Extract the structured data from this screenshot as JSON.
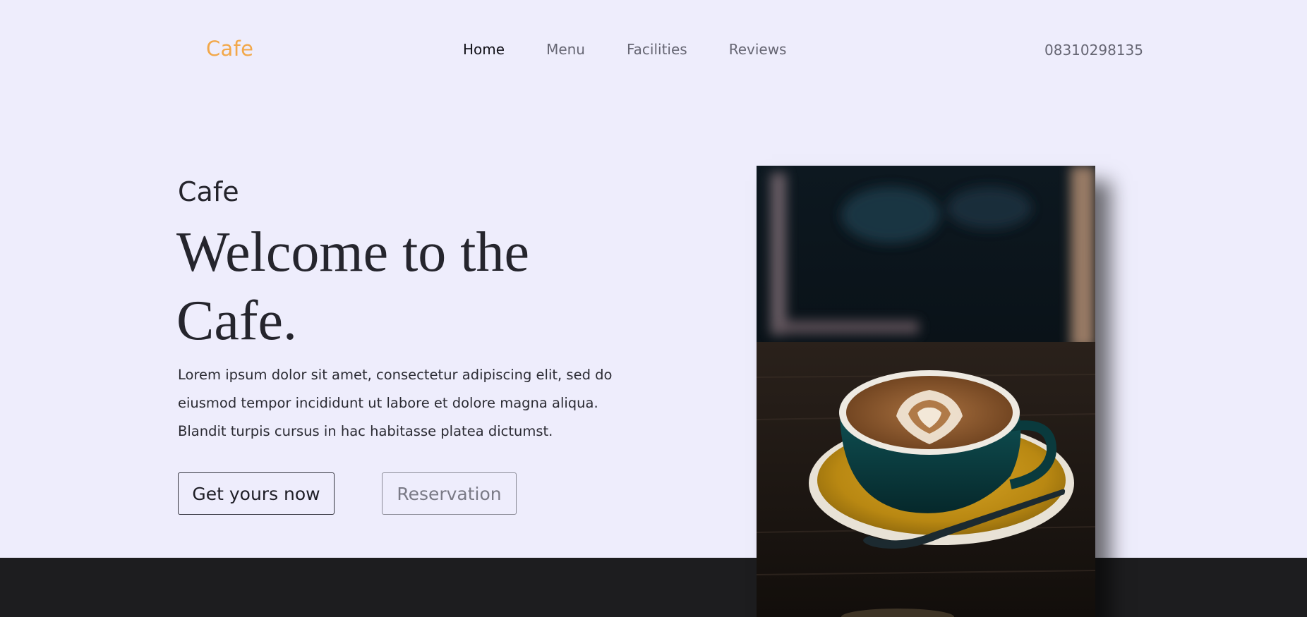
{
  "brand": {
    "name": "Cafe",
    "color": "#f2a84a"
  },
  "nav": {
    "items": [
      {
        "label": "Home",
        "active": true
      },
      {
        "label": "Menu",
        "active": false
      },
      {
        "label": "Facilities",
        "active": false
      },
      {
        "label": "Reviews",
        "active": false
      }
    ]
  },
  "contact": {
    "phone": "08310298135"
  },
  "hero": {
    "eyebrow": "Cafe",
    "headline_line1": "Welcome to the",
    "headline_line2": "Cafe.",
    "lede_line1": "Lorem ipsum dolor sit amet, consectetur adipiscing elit, sed do",
    "lede_line2": "eiusmod tempor incididunt ut labore et dolore magna aliqua.",
    "lede_line3": "Blandit turpis cursus in hac habitasse platea dictumst.",
    "primary_button": "Get yours now",
    "secondary_button": "Reservation",
    "image_subject": "latte-art-coffee-cup-icon"
  },
  "colors": {
    "background": "#eeedfc",
    "footer_band": "#1d1d1f",
    "text": "#25252d"
  }
}
